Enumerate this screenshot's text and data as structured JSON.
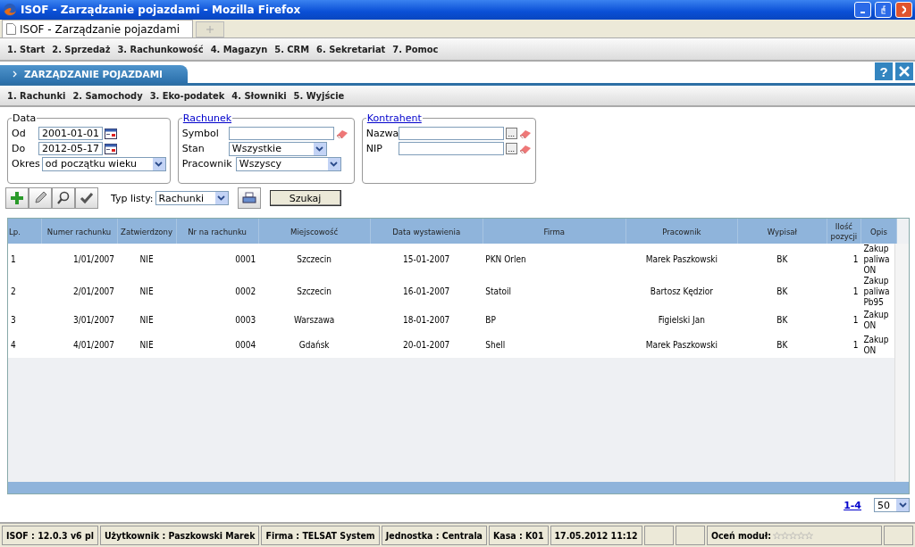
{
  "window": {
    "title": "ISOF - Zarządzanie pojazdami - Mozilla Firefox"
  },
  "browser_tab": {
    "title": "ISOF - Zarządzanie pojazdami"
  },
  "main_menu": [
    "1. Start",
    "2. Sprzedaż",
    "3. Rachunkowość",
    "4. Magazyn",
    "5. CRM",
    "6. Sekretariat",
    "7. Pomoc"
  ],
  "module": {
    "title": "ZARZĄDZANIE POJAZDAMI",
    "help": "?"
  },
  "sub_menu": [
    "1. Rachunki",
    "2. Samochody",
    "3. Eko-podatek",
    "4. Słowniki",
    "5. Wyjście"
  ],
  "filters": {
    "data": {
      "legend": "Data",
      "from_label": "Od",
      "from_value": "2001-01-01",
      "to_label": "Do",
      "to_value": "2012-05-17",
      "period_label": "Okres",
      "period_value": "od początku wieku"
    },
    "rachunek": {
      "legend": "Rachunek",
      "symbol_label": "Symbol",
      "state_label": "Stan",
      "state_value": "Wszystkie",
      "employee_label": "Pracownik",
      "employee_value": "Wszyscy"
    },
    "kontrahent": {
      "legend": "Kontrahent",
      "name_label": "Nazwa",
      "nip_label": "NIP",
      "lookup": "..."
    }
  },
  "toolbar": {
    "list_type_label": "Typ listy:",
    "list_type_value": "Rachunki",
    "search_button": "Szukaj"
  },
  "table": {
    "columns": [
      "Lp.",
      "Numer rachunku",
      "Zatwierdzony",
      "Nr na rachunku",
      "Miejscowość",
      "Data wystawienia",
      "Firma",
      "Pracownik",
      "Wypisał",
      "Ilość pozycji",
      "Opis"
    ],
    "rows": [
      [
        "1",
        "1/01/2007",
        "NIE",
        "0001",
        "Szczecin",
        "15-01-2007",
        "PKN Orlen",
        "Marek Paszkowski",
        "BK",
        "1",
        "Zakup paliwa ON"
      ],
      [
        "2",
        "2/01/2007",
        "NIE",
        "0002",
        "Szczecin",
        "16-01-2007",
        "Statoil",
        "Bartosz Kędzior",
        "BK",
        "1",
        "Zakup paliwa Pb95"
      ],
      [
        "3",
        "3/01/2007",
        "NIE",
        "0003",
        "Warszawa",
        "18-01-2007",
        "BP",
        "Figielski Jan",
        "BK",
        "1",
        "Zakup ON"
      ],
      [
        "4",
        "4/01/2007",
        "NIE",
        "0004",
        "Gdańsk",
        "20-01-2007",
        "Shell",
        "Marek Paszkowski",
        "BK",
        "1",
        "Zakup ON"
      ]
    ]
  },
  "pager": {
    "range": "1-4",
    "page_size": "50"
  },
  "status_bar": {
    "items": [
      "ISOF : 12.0.3 v6 pl",
      "Użytkownik : Paszkowski Marek",
      "Firma : TELSAT System",
      "Jednostka : Centrala",
      "Kasa : K01",
      "17.05.2012 11:12"
    ],
    "rating_label": "Oceń moduł:",
    "stars": 0
  }
}
